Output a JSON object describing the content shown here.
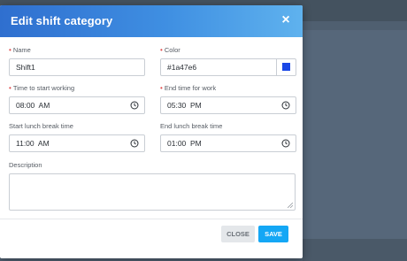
{
  "dialog": {
    "title": "Edit shift category",
    "close_symbol": "×"
  },
  "fields": {
    "name": {
      "label": "Name",
      "value": "Shift1",
      "required": true
    },
    "color": {
      "label": "Color",
      "value": "#1a47e6",
      "required": true,
      "swatch": "#1a47e6"
    },
    "start_work": {
      "label": "Time to start working",
      "value": "08:00  AM",
      "required": true
    },
    "end_work": {
      "label": "End time for work",
      "value": "05:30  PM",
      "required": true
    },
    "start_lunch": {
      "label": "Start lunch break time",
      "value": "11:00  AM",
      "required": false
    },
    "end_lunch": {
      "label": "End lunch break time",
      "value": "01:00  PM",
      "required": false
    },
    "description": {
      "label": "Description",
      "value": ""
    }
  },
  "buttons": {
    "close": "CLOSE",
    "save": "SAVE"
  },
  "colors": {
    "header_start": "#2f6fcf",
    "header_end": "#5fb2ee",
    "save_button": "#14a7f5",
    "required_mark": "#e04a4a"
  },
  "icons": {
    "time_field": "clock-icon",
    "close": "close-icon"
  }
}
